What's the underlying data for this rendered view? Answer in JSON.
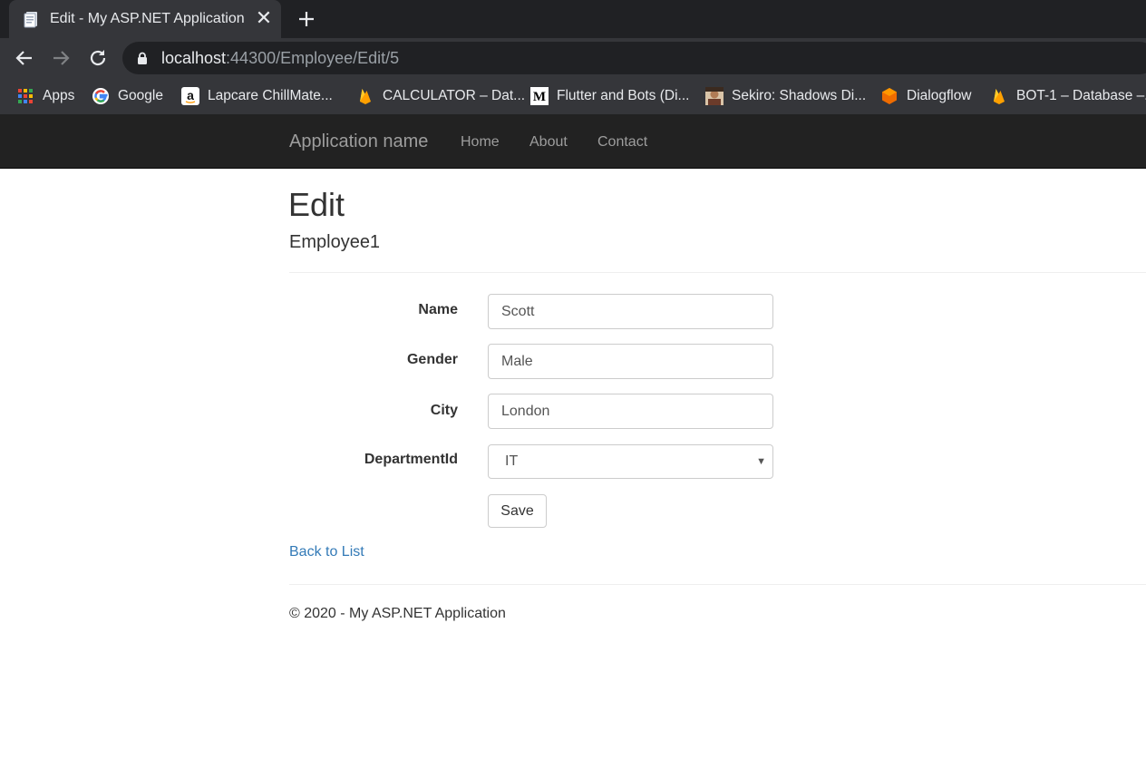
{
  "browser": {
    "tab_title": "Edit - My ASP.NET Application",
    "tab_close": "✕",
    "url_host": "localhost",
    "url_rest": ":44300/Employee/Edit/5",
    "bookmarks": [
      {
        "label": "Apps",
        "icon": "apps-grid-icon"
      },
      {
        "label": "Google",
        "icon": "google-icon"
      },
      {
        "label": "Lapcare ChillMate...",
        "icon": "amazon-icon"
      },
      {
        "label": "CALCULATOR – Dat...",
        "icon": "firebase-icon"
      },
      {
        "label": "Flutter and Bots (Di...",
        "icon": "medium-icon"
      },
      {
        "label": "Sekiro: Shadows Di...",
        "icon": "avatar-icon"
      },
      {
        "label": "Dialogflow",
        "icon": "dialogflow-icon"
      },
      {
        "label": "BOT-1 – Database –...",
        "icon": "firebase-icon"
      }
    ]
  },
  "navbar": {
    "brand": "Application name",
    "links": [
      "Home",
      "About",
      "Contact"
    ]
  },
  "page": {
    "title": "Edit",
    "subtitle": "Employee1"
  },
  "form": {
    "name_label": "Name",
    "name_value": "Scott",
    "gender_label": "Gender",
    "gender_value": "Male",
    "city_label": "City",
    "city_value": "London",
    "department_label": "DepartmentId",
    "department_value": "IT",
    "save_label": "Save"
  },
  "back_link": "Back to List",
  "footer": "© 2020 - My ASP.NET Application",
  "colors": {
    "chrome_dark": "#202124",
    "chrome_toolbar": "#35363a",
    "navbar_bg": "#222222",
    "link_blue": "#337ab7"
  }
}
